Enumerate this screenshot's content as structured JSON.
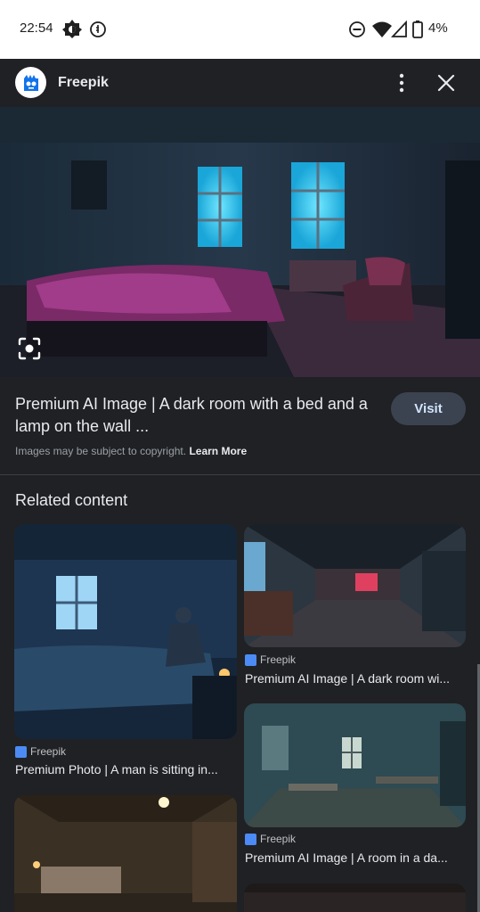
{
  "status_bar": {
    "time": "22:54",
    "battery": "4%"
  },
  "header": {
    "site_name": "Freepik"
  },
  "result": {
    "title": "Premium AI Image | A dark room with a bed and a lamp on the wall ...",
    "visit_label": "Visit",
    "copyright_text": "Images may be subject to copyright. ",
    "learn_more_label": "Learn More"
  },
  "related": {
    "heading": "Related content",
    "items": [
      {
        "source": "Freepik",
        "title": "Premium Photo | A man is sitting in..."
      },
      {
        "source": "Freepik",
        "title": "Premium AI Image | A dark room wi..."
      },
      {
        "source": "Freepik",
        "title": "Premium AI Image | A room in a da..."
      }
    ]
  },
  "colors": {
    "background": "#202124",
    "status_bar": "#ffffff",
    "visit_button": "#3c4350",
    "accent": "#d2e3fc"
  }
}
